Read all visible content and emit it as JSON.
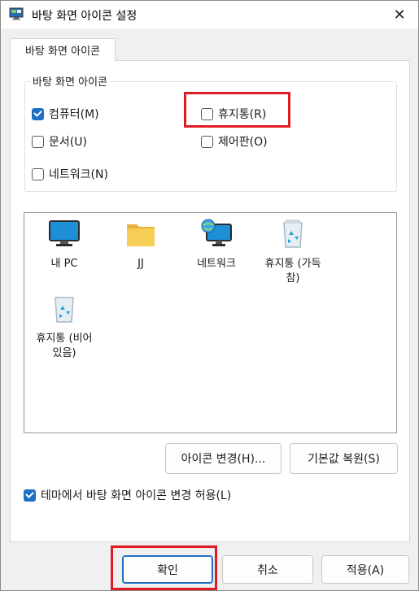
{
  "window": {
    "title": "바탕 화면 아이콘 설정",
    "close_glyph": "✕"
  },
  "tabs": [
    {
      "label": "바탕 화면 아이콘"
    }
  ],
  "group": {
    "legend": "바탕 화면 아이콘",
    "checkboxes": [
      {
        "label": "컴퓨터(M)",
        "checked": true
      },
      {
        "label": "휴지통(R)",
        "checked": false
      },
      {
        "label": "문서(U)",
        "checked": false
      },
      {
        "label": "제어판(O)",
        "checked": false
      },
      {
        "label": "네트워크(N)",
        "checked": false
      }
    ]
  },
  "icons": [
    {
      "label": "내 PC",
      "icon": "monitor-icon"
    },
    {
      "label": "JJ",
      "icon": "folder-icon"
    },
    {
      "label": "네트워크",
      "icon": "network-icon"
    },
    {
      "label_line1": "휴지통 (가득",
      "label_line2": "참)",
      "icon": "recycle-bin-full-icon"
    },
    {
      "label_line1": "휴지통 (비어",
      "label_line2": "있음)",
      "icon": "recycle-bin-empty-icon"
    }
  ],
  "buttons": {
    "change_icon": "아이콘 변경(H)...",
    "restore_default": "기본값 복원(S)",
    "ok": "확인",
    "cancel": "취소",
    "apply": "적용(A)"
  },
  "theme_checkbox": {
    "label": "테마에서 바탕 화면 아이콘 변경 허용(L)",
    "checked": true
  },
  "colors": {
    "accent": "#1d6fc4",
    "highlight": "#e01b24"
  }
}
